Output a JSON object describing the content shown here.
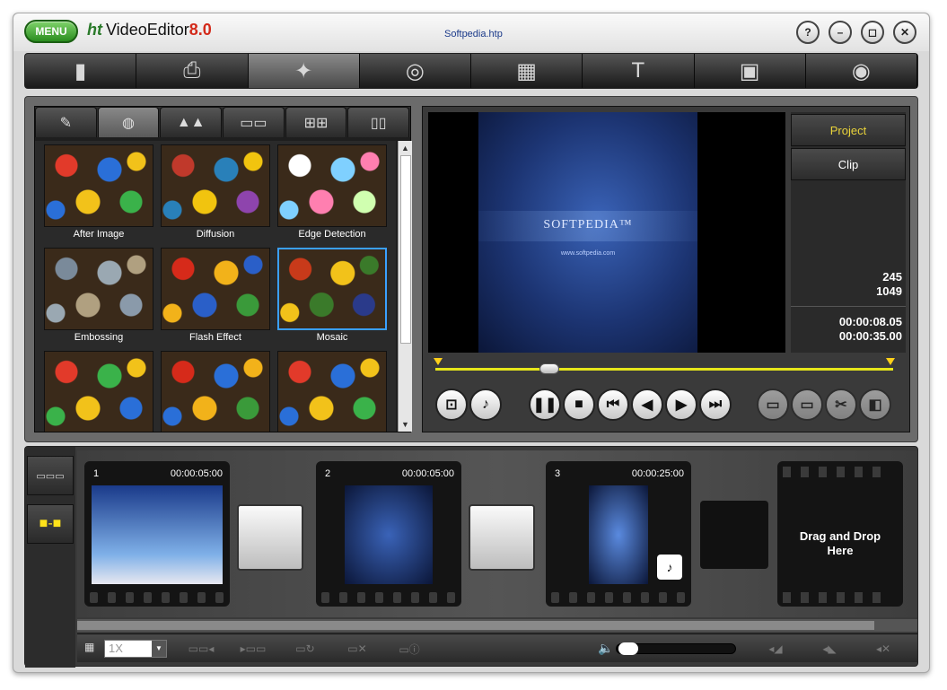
{
  "app": {
    "menu_label": "MENU",
    "logo_prefix": "ht",
    "logo_name": "VideoEditor",
    "logo_version": "8.0",
    "window_title": "Softpedia.htp",
    "window_buttons": [
      "?",
      "–",
      "◻",
      "✕"
    ]
  },
  "toolbar": {
    "items": [
      {
        "name": "new-project-icon",
        "glyph": "▮"
      },
      {
        "name": "capture-icon",
        "glyph": "⎙"
      },
      {
        "name": "effects-wand-icon",
        "glyph": "✦"
      },
      {
        "name": "transitions-icon",
        "glyph": "◎"
      },
      {
        "name": "film-clips-icon",
        "glyph": "▦"
      },
      {
        "name": "text-icon",
        "glyph": "T"
      },
      {
        "name": "save-icon",
        "glyph": "▣"
      },
      {
        "name": "burn-disc-icon",
        "glyph": "◉"
      }
    ],
    "active_index": 2
  },
  "effects": {
    "tabs": [
      "✎",
      "◍",
      "▲▲",
      "▭▭",
      "⊞⊞",
      "▯▯"
    ],
    "active_tab": 1,
    "items": [
      {
        "label": "After Image",
        "colors": [
          "#e23a2a",
          "#2a6fd8",
          "#f2c21a",
          "#3ab24a"
        ]
      },
      {
        "label": "Diffusion",
        "colors": [
          "#c0392b",
          "#2980b9",
          "#f1c40f",
          "#8e44ad"
        ]
      },
      {
        "label": "Edge Detection",
        "colors": [
          "#ffffff",
          "#7fd0ff",
          "#ff7fb0",
          "#d0ffb0"
        ]
      },
      {
        "label": "Embossing",
        "colors": [
          "#7a8a9a",
          "#9aa8b2",
          "#b0a080",
          "#8a9aaa"
        ]
      },
      {
        "label": "Flash Effect",
        "colors": [
          "#d62a1a",
          "#f2b21a",
          "#2a5fc8",
          "#3a9a3a"
        ]
      },
      {
        "label": "Mosaic",
        "colors": [
          "#c83a1a",
          "#f2c21a",
          "#3a7a2a",
          "#2a3a8a"
        ]
      },
      {
        "label": "",
        "colors": [
          "#e23a2a",
          "#3ab24a",
          "#f2c21a",
          "#2a6fd8"
        ]
      },
      {
        "label": "",
        "colors": [
          "#d62a1a",
          "#2a6fd8",
          "#f2b21a",
          "#3a9a3a"
        ]
      },
      {
        "label": "",
        "colors": [
          "#e23a2a",
          "#2a6fd8",
          "#f2c21a",
          "#3ab24a"
        ]
      }
    ],
    "selected_index": 5
  },
  "preview": {
    "brand_text": "SOFTPEDIA™",
    "url_text": "www.softpedia.com",
    "project_label": "Project",
    "clip_label": "Clip",
    "frame_current": "245",
    "frame_total": "1049",
    "time_current": "00:00:08.05",
    "time_total": "00:00:35.00"
  },
  "timeline": {
    "clips": [
      {
        "num": "1",
        "duration": "00:00:05:00"
      },
      {
        "num": "2",
        "duration": "00:00:05:00"
      },
      {
        "num": "3",
        "duration": "00:00:25:00"
      }
    ],
    "drop_text_1": "Drag and Drop",
    "drop_text_2": "Here",
    "zoom_value": "1X"
  },
  "colors": {
    "accent_yellow": "#e8d23a",
    "selection_blue": "#3aa0ff",
    "menu_green": "#2a8d1e"
  }
}
